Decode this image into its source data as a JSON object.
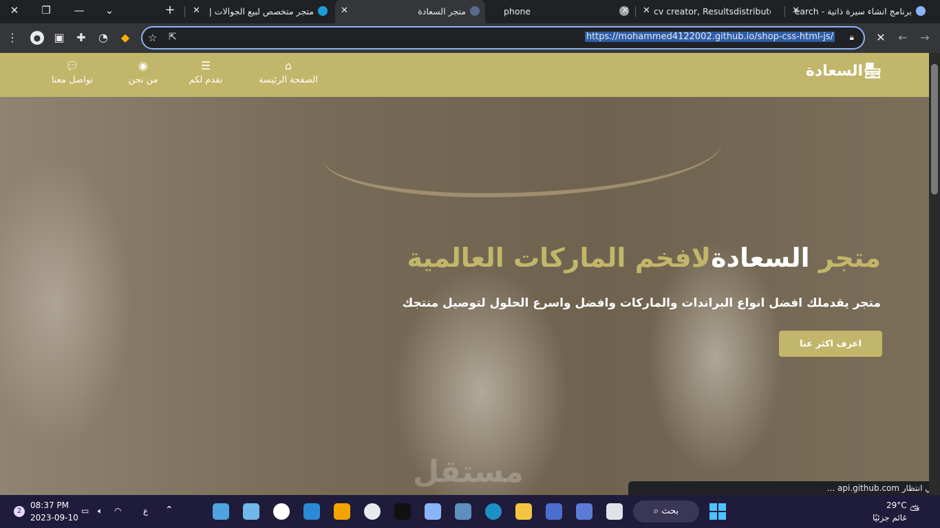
{
  "browser": {
    "tabs": [
      {
        "label": "برنامج انشاء سيرة ذاتية - Search",
        "active": false
      },
      {
        "label": "cv creator, Resultsdistributor",
        "active": false
      },
      {
        "label": "phone",
        "active": false
      },
      {
        "label": "متجر السعادة",
        "active": true
      },
      {
        "label": "متجر متخصص لبيع الجوالات |",
        "active": false
      }
    ],
    "new_tab_symbol": "+",
    "url": "https://mohammed4122002.github.io/shop-css-html-js/",
    "status_text": "في انتظار api.github.com ..."
  },
  "site": {
    "logo": "السعادة",
    "nav": [
      {
        "label": "الصفحة الرئيسة",
        "icon": "home-icon"
      },
      {
        "label": "نقدم لكم",
        "icon": "server-icon"
      },
      {
        "label": "من نحن",
        "icon": "user-circle-icon"
      },
      {
        "label": "تواصل معنا",
        "icon": "chat-icon"
      }
    ],
    "hero": {
      "title_part1": "متجر",
      "title_part2": "السعادة",
      "title_part3": "لافخم الماركات العالمية",
      "subtitle": "متجر يقدملك افضل انواع البراندات والماركات وافضل واسرع الحلول لتوصيل منتجك",
      "button": "اعرف اكثر عنا"
    },
    "watermark": "مستقل"
  },
  "taskbar": {
    "time": "08:37 PM",
    "date": "2023-09-10",
    "notification_count": "2",
    "input_lang": "ع",
    "search_label": "بحث",
    "weather_temp": "29°C",
    "weather_desc": "غائم جزئيًا"
  },
  "colors": {
    "brand": "#c2b66a",
    "browser_bg": "#202124",
    "toolbar_bg": "#35363a",
    "focus_ring": "#8ab4f8",
    "taskbar_bg": "#1f1b3a"
  }
}
